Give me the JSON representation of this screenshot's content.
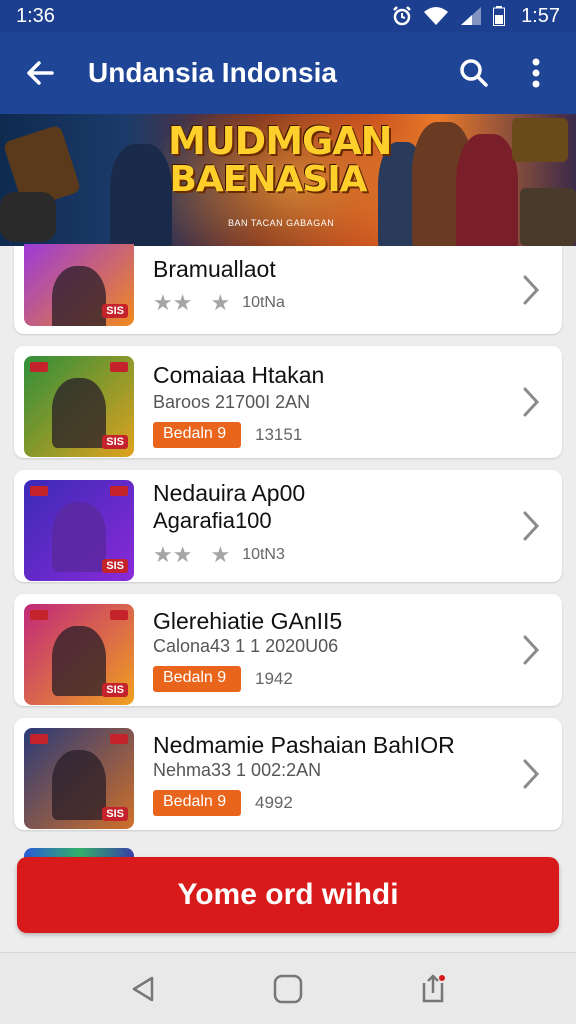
{
  "status_bar": {
    "time_left": "1:36",
    "time_right": "1:57"
  },
  "app_bar": {
    "title": "Undansia Indonsia"
  },
  "banner": {
    "headline_line1": "MUDMGAN",
    "headline_line2": "BAENASIA",
    "subline": "BAN TACAN GABAGAN"
  },
  "games": [
    {
      "name": "Bramuallaot",
      "rating_count": "10tNa",
      "thumb_tag": "SIS",
      "thumb_colors": [
        "#9c3ad8",
        "#f08a1e"
      ]
    },
    {
      "name": "Comaiaa Htakan",
      "subtitle": "Baroos 21700I 2AN",
      "badge": "Bedaln 9",
      "count": "13151",
      "thumb_tag": "SIS",
      "thumb_colors": [
        "#2f8f3a",
        "#e0a21e"
      ]
    },
    {
      "name": "Nedauira Ap00",
      "subtitle2": "Agarafia100",
      "rating_count": "10tN3",
      "thumb_tag": "SIS",
      "thumb_colors": [
        "#3a2ab8",
        "#8a2ad8"
      ]
    },
    {
      "name": "Glerehiatie GAnII5",
      "subtitle": "Calona43 1 1 2020U06",
      "badge": "Bedaln 9",
      "count": "1942",
      "thumb_tag": "SIS",
      "thumb_colors": [
        "#c0287a",
        "#f0a020"
      ]
    },
    {
      "name": "Nedmamie Pashaian BahIOR",
      "subtitle": "Nehma33 1 002:2AN",
      "badge": "Bedaln 9",
      "count": "4992",
      "thumb_tag": "SIS",
      "thumb_colors": [
        "#2a3a78",
        "#d0702a"
      ]
    }
  ],
  "cta": {
    "label": "Yome ord wihdi"
  },
  "colors": {
    "app_bar": "#1f4596",
    "status_bar": "#1d3f8f",
    "cta": "#d81a1a",
    "badge": "#e8651b"
  }
}
